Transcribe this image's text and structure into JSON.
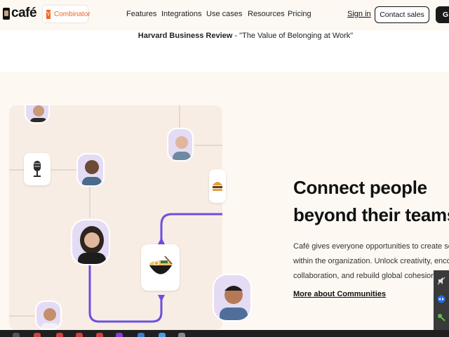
{
  "nav": {
    "logo_text": "café",
    "yc_mark": "Y",
    "yc_text": "Combinator",
    "links": [
      "Features",
      "Integrations",
      "Use cases",
      "Resources",
      "Pricing"
    ],
    "signin": "Sign in",
    "contact": "Contact sales",
    "cta_partial": "G"
  },
  "quote": {
    "source": "Harvard Business Review",
    "title": " - \"The Value of Belonging at Work\""
  },
  "section": {
    "heading_line1": "Connect people",
    "heading_line2": "beyond their teams",
    "body_line1": "Café gives everyone opportunities to create so",
    "body_line2": "within the organization. Unlock creativity, enco",
    "body_line3": "collaboration, and rebuild global cohesion.",
    "more_link": "More about Communities"
  },
  "colors": {
    "nav_bg": "#fdf8f2",
    "illus_bg": "#f8ede4",
    "purple_line": "#6b4fe0",
    "avatar_bg": "#e4dcf5"
  },
  "icons": [
    "microphone-icon",
    "ramen-bowl-icon",
    "burger-icon",
    "mute-icon",
    "teamviewer-icon",
    "key-icon"
  ]
}
